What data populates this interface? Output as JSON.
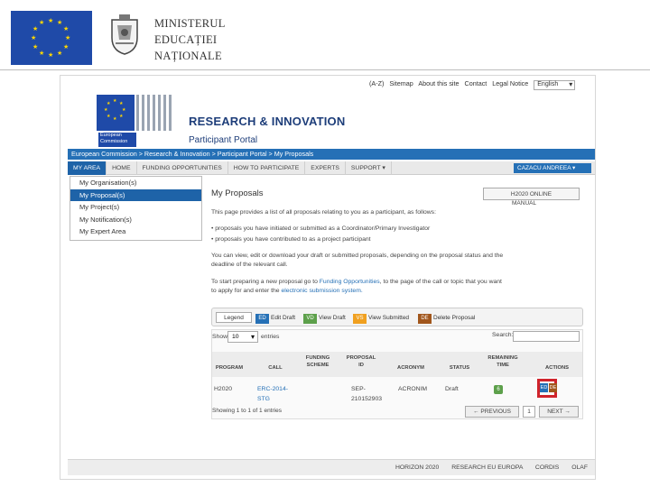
{
  "slide_header": {
    "ministry_lines": [
      "MINISTERUL",
      "EDUCAȚIEI",
      "NAȚIONALE"
    ]
  },
  "top_links": {
    "items": [
      "(A-Z)",
      "Sitemap",
      "About this site",
      "Contact",
      "Legal Notice"
    ],
    "language": "English"
  },
  "ec_logo": {
    "lines": [
      "European",
      "Commission"
    ]
  },
  "header": {
    "title": "RESEARCH & INNOVATION",
    "subtitle": "Participant Portal"
  },
  "breadcrumb": "European Commission > Research & Innovation > Participant Portal > My Proposals",
  "nav": {
    "items": [
      "MY AREA",
      "HOME",
      "FUNDING OPPORTUNITIES",
      "HOW TO PARTICIPATE",
      "EXPERTS",
      "SUPPORT ▾"
    ],
    "user": "CAZACU ANDREEA ▾"
  },
  "dropdown": {
    "items": [
      "My Organisation(s)",
      "My Proposal(s)",
      "My Project(s)",
      "My Notification(s)",
      "My Expert Area"
    ]
  },
  "main": {
    "heading": "My Proposals",
    "manual_line1": "H2020 ONLINE",
    "manual_line2": "MANUAL",
    "intro": "This page provides a list of all proposals relating to you as a participant, as follows:",
    "bullet1": "• proposals you have initiated or submitted as a Coordinator/Primary Investigator",
    "bullet2": "• proposals you have contributed to as a project participant",
    "para2_line1": "You can view, edit or download your draft or submitted proposals, depending on the proposal status and the",
    "para2_line2": "deadline of the relevant call.",
    "para3_pre": "To start preparing a new proposal go to",
    "para3_link": "Funding Opportunities",
    "para3_post": ", to the page of the call or topic that you want",
    "para4_pre": "to apply for and enter the",
    "para4_link": "electronic submission system."
  },
  "legend": {
    "title": "Legend",
    "items": [
      {
        "code": "ED",
        "label": "Edit Draft",
        "color": "#2570b6"
      },
      {
        "code": "VD",
        "label": "View Draft",
        "color": "#5da04b"
      },
      {
        "code": "VS",
        "label": "View Submitted",
        "color": "#f0a020"
      },
      {
        "code": "DE",
        "label": "Delete Proposal",
        "color": "#a1561c"
      }
    ]
  },
  "table": {
    "show_label": "Show",
    "show_value": "10",
    "entries_label": "entries",
    "search_label": "Search:",
    "columns": [
      "PROGRAM",
      "CALL",
      "FUNDING SCHEME",
      "PROPOSAL ID",
      "ACRONYM",
      "STATUS",
      "REMAINING TIME",
      "ACTIONS"
    ],
    "row": {
      "program": "H2020",
      "call_line1": "ERC-2014-",
      "call_line2": "STG",
      "proposal_line1": "SEP-",
      "proposal_line2": "210152903",
      "acronym": "ACRONIM",
      "status": "Draft",
      "remaining": "6",
      "action_ed": "ED",
      "action_de": "DE"
    },
    "info": "Showing 1 to 1 of 1 entries",
    "prev": "← PREVIOUS",
    "page": "1",
    "next": "NEXT →"
  },
  "footer": {
    "links": [
      "HORIZON 2020",
      "RESEARCH EU EUROPA",
      "CORDIS",
      "OLAF"
    ]
  }
}
